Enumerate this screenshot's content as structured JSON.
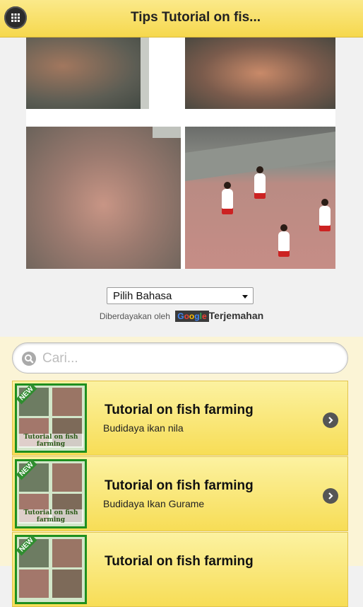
{
  "header": {
    "title": "Tips Tutorial on fis...",
    "menu_icon": "grid-menu-icon"
  },
  "translate": {
    "select_value": "Pilih Bahasa",
    "powered_by": "Diberdayakan oleh",
    "google_logo": "Google",
    "translate_label": "Terjemahan"
  },
  "search": {
    "placeholder": "Cari..."
  },
  "list": {
    "items": [
      {
        "title": "Tutorial on fish farming",
        "subtitle": "Budidaya ikan nila",
        "thumb_badge": "NEW",
        "thumb_caption": "Tutorial on fish farming"
      },
      {
        "title": "Tutorial on fish farming",
        "subtitle": "Budidaya Ikan Gurame",
        "thumb_badge": "NEW",
        "thumb_caption": "Tutorial on fish farming"
      },
      {
        "title": "Tutorial on fish farming",
        "subtitle": "",
        "thumb_badge": "NEW",
        "thumb_caption": ""
      }
    ]
  },
  "colors": {
    "header_yellow": "#f6d84d",
    "list_green": "#1f8f1f",
    "chevron": "#555555"
  }
}
